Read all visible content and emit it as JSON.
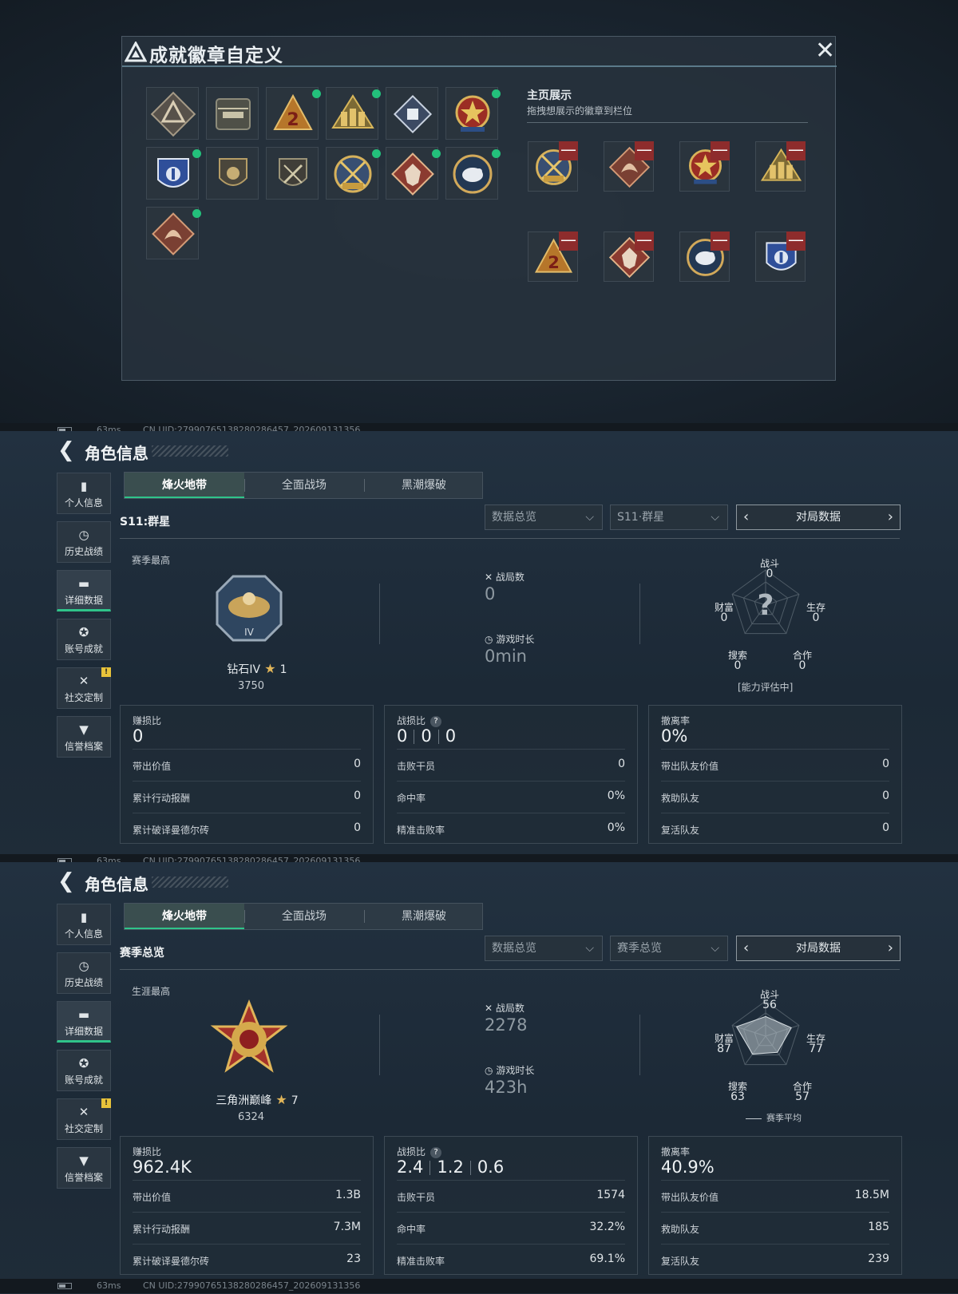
{
  "badge_modal": {
    "title": "成就徽章自定义",
    "close_icon": "close-icon",
    "showcase_title": "主页展示",
    "showcase_sub": "拖拽想展示的徽章到栏位",
    "grid": [
      {
        "icon": "triangle-logo-badge",
        "new": false
      },
      {
        "icon": "helicopter-badge",
        "new": false
      },
      {
        "icon": "number-2-badge",
        "new": true
      },
      {
        "icon": "soldiers-badge",
        "new": true
      },
      {
        "icon": "cube-badge",
        "new": false
      },
      {
        "icon": "star-emblem-badge",
        "new": true
      },
      {
        "icon": "police-shield-badge",
        "new": true
      },
      {
        "icon": "lion-shield-badge",
        "new": false
      },
      {
        "icon": "crossed-rifle-badge",
        "new": false
      },
      {
        "icon": "crossed-swords-badge",
        "new": true
      },
      {
        "icon": "wolf-diamond-badge",
        "new": true
      },
      {
        "icon": "eagle-round-badge",
        "new": true
      },
      {
        "icon": "dragon-diamond-badge",
        "new": true
      }
    ],
    "slots": [
      {
        "icon": "crossed-swords-badge"
      },
      {
        "icon": "dragon-diamond-badge"
      },
      {
        "icon": "star-emblem-badge"
      },
      {
        "icon": "soldiers-badge"
      },
      {
        "icon": "number-2-badge"
      },
      {
        "icon": "wolf-diamond-badge"
      },
      {
        "icon": "eagle-round-badge"
      },
      {
        "icon": "police-shield-badge"
      }
    ],
    "remove_label": "—"
  },
  "status_bar": {
    "ms": "63ms",
    "uid": "CN UID:279907651382802864​57_202609131356"
  },
  "panels": [
    {
      "title": "角色信息",
      "nav": [
        {
          "icon": "bar-chart-icon",
          "label": "个人信息",
          "active": false,
          "warn": false
        },
        {
          "icon": "clock-icon",
          "label": "历史战绩",
          "active": false,
          "warn": false
        },
        {
          "icon": "folder-icon",
          "label": "详细数据",
          "active": true,
          "warn": false
        },
        {
          "icon": "medal-icon",
          "label": "账号成就",
          "active": false,
          "warn": false
        },
        {
          "icon": "tools-icon",
          "label": "社交定制",
          "active": false,
          "warn": true
        },
        {
          "icon": "shield-check-icon",
          "label": "信誉档案",
          "active": false,
          "warn": false
        }
      ],
      "tabs": [
        "烽火地带",
        "全面战场",
        "黑潮爆破"
      ],
      "subtitle": "S11:群星",
      "dropdown1": "数据总览",
      "dropdown2": "S11·群星",
      "mode": "对局数据",
      "best_label": "赛季最高",
      "rank_name": "钻石IV",
      "rank_stars": "1",
      "rank_points": "3750",
      "matches_label": "战局数",
      "matches": "0",
      "time_label": "游戏时长",
      "time": "0min",
      "radar": {
        "combat": "0",
        "survival": "0",
        "coop": "0",
        "search": "0",
        "wealth": "0",
        "values": [
          0,
          0,
          0,
          0,
          0
        ],
        "unknown": true
      },
      "radar_labels": {
        "combat": "战斗",
        "survival": "生存",
        "coop": "合作",
        "search": "搜索",
        "wealth": "财富"
      },
      "radar_note": "[能力评估中]",
      "cards": [
        {
          "title": "赚损比",
          "value": "0",
          "rows": [
            [
              "带出价值",
              "0"
            ],
            [
              "累计行动报酬",
              "0"
            ],
            [
              "累计破译曼德尔砖",
              "0"
            ]
          ]
        },
        {
          "title": "战损比",
          "kd": [
            "0",
            "0",
            "0"
          ],
          "rows": [
            [
              "击败干员",
              "0"
            ],
            [
              "命中率",
              "0%"
            ],
            [
              "精准击败率",
              "0%"
            ]
          ]
        },
        {
          "title": "撤离率",
          "value": "0%",
          "rows": [
            [
              "带出队友价值",
              "0"
            ],
            [
              "救助队友",
              "0"
            ],
            [
              "复活队友",
              "0"
            ]
          ]
        }
      ]
    },
    {
      "title": "角色信息",
      "nav": [
        {
          "icon": "bar-chart-icon",
          "label": "个人信息",
          "active": false,
          "warn": false
        },
        {
          "icon": "clock-icon",
          "label": "历史战绩",
          "active": false,
          "warn": false
        },
        {
          "icon": "folder-icon",
          "label": "详细数据",
          "active": true,
          "warn": false
        },
        {
          "icon": "medal-icon",
          "label": "账号成就",
          "active": false,
          "warn": false
        },
        {
          "icon": "tools-icon",
          "label": "社交定制",
          "active": false,
          "warn": true
        },
        {
          "icon": "shield-check-icon",
          "label": "信誉档案",
          "active": false,
          "warn": false
        }
      ],
      "tabs": [
        "烽火地带",
        "全面战场",
        "黑潮爆破"
      ],
      "subtitle": "赛季总览",
      "dropdown1": "数据总览",
      "dropdown2": "赛季总览",
      "mode": "对局数据",
      "best_label": "生涯最高",
      "rank_name": "三角洲巅峰",
      "rank_stars": "7",
      "rank_points": "6324",
      "matches_label": "战局数",
      "matches": "2278",
      "time_label": "游戏时长",
      "time": "423h",
      "radar": {
        "combat": "56",
        "survival": "77",
        "coop": "57",
        "search": "63",
        "wealth": "87",
        "values": [
          56,
          77,
          57,
          63,
          87
        ],
        "unknown": false
      },
      "radar_labels": {
        "combat": "战斗",
        "survival": "生存",
        "coop": "合作",
        "search": "搜索",
        "wealth": "财富"
      },
      "radar_note": "赛季平均",
      "cards": [
        {
          "title": "赚损比",
          "value": "962.4K",
          "rows": [
            [
              "带出价值",
              "1.3B"
            ],
            [
              "累计行动报酬",
              "7.3M"
            ],
            [
              "累计破译曼德尔砖",
              "23"
            ]
          ]
        },
        {
          "title": "战损比",
          "kd": [
            "2.4",
            "1.2",
            "0.6"
          ],
          "rows": [
            [
              "击败干员",
              "1574"
            ],
            [
              "命中率",
              "32.2%"
            ],
            [
              "精准击败率",
              "69.1%"
            ]
          ]
        },
        {
          "title": "撤离率",
          "value": "40.9%",
          "rows": [
            [
              "带出队友价值",
              "18.5M"
            ],
            [
              "救助队友",
              "185"
            ],
            [
              "复活队友",
              "239"
            ]
          ]
        }
      ]
    }
  ]
}
